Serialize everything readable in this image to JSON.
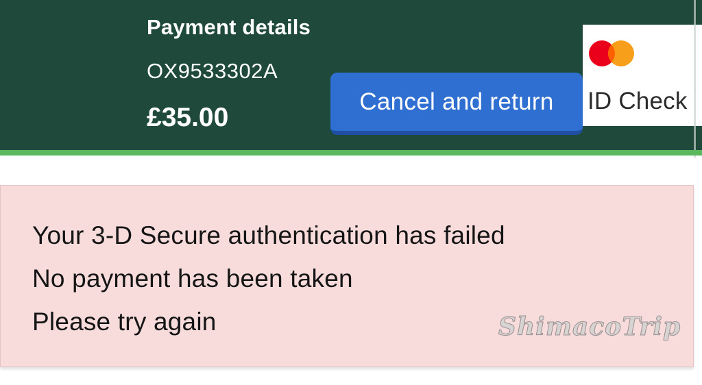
{
  "header": {
    "title": "Payment details",
    "reference": "OX9533302A",
    "amount": "£35.00",
    "background_color": "#1f4a3b",
    "stripe_color": "#5cb85c"
  },
  "actions": {
    "cancel_label": "Cancel and return",
    "button_color": "#2f6fd1"
  },
  "brand": {
    "logo_icon": "mastercard-logo-icon",
    "label": "ID Check"
  },
  "error": {
    "lines": [
      "Your 3-D Secure authentication has failed",
      "No payment has been taken",
      "Please try again"
    ],
    "background_color": "#f8dcdc"
  },
  "watermark": {
    "text": "ShimacoTrip"
  }
}
